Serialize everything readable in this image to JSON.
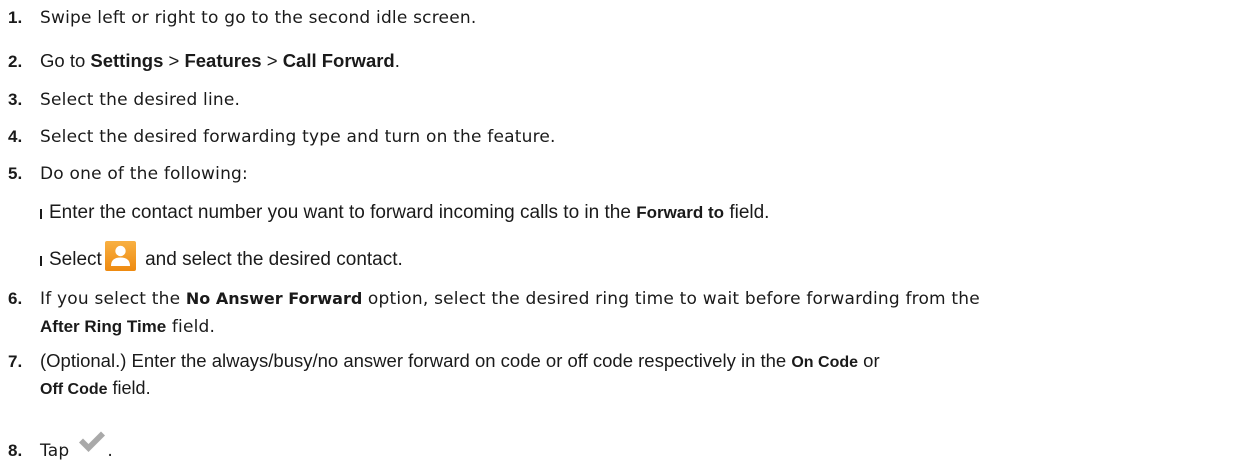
{
  "steps": [
    {
      "num": "1.",
      "text": "Swipe left or right to go to the second idle screen."
    },
    {
      "num": "2.",
      "pre": "Go to ",
      "b1": "Settings",
      "sep1": " > ",
      "b2": "Features",
      "sep2": " > ",
      "b3": "Call Forward",
      "post": "."
    },
    {
      "num": "3.",
      "text": "Select the desired line."
    },
    {
      "num": "4.",
      "text": "Select the desired forwarding type and turn on the feature."
    },
    {
      "num": "5.",
      "text": "Do one of the following:"
    },
    {
      "num": "6.",
      "pre": "If you select the ",
      "bold": "No Answer Forward",
      "post": " option, select the desired ring time to wait before forwarding from the",
      "line2_bold": "After Ring Time",
      "line2_post": " field."
    },
    {
      "num": "7.",
      "pre": "(Optional.) Enter the always/busy/no answer forward on code or off code respectively in the ",
      "bold": "On Code",
      "post": " or",
      "line2_bold": "Off Code",
      "line2_post": " field."
    },
    {
      "num": "8.",
      "text": "Tap",
      "post": "."
    }
  ],
  "substeps": [
    {
      "pre": "Enter the contact number you want to forward incoming calls to in the ",
      "bold": "Forward to",
      "post": " field."
    },
    {
      "pre": "Select",
      "post": " and select the desired contact."
    }
  ],
  "icons": {
    "contact": "contact-icon",
    "check": "check-icon",
    "contact_color": "#F39B1E",
    "check_color": "#A9A9A9"
  }
}
